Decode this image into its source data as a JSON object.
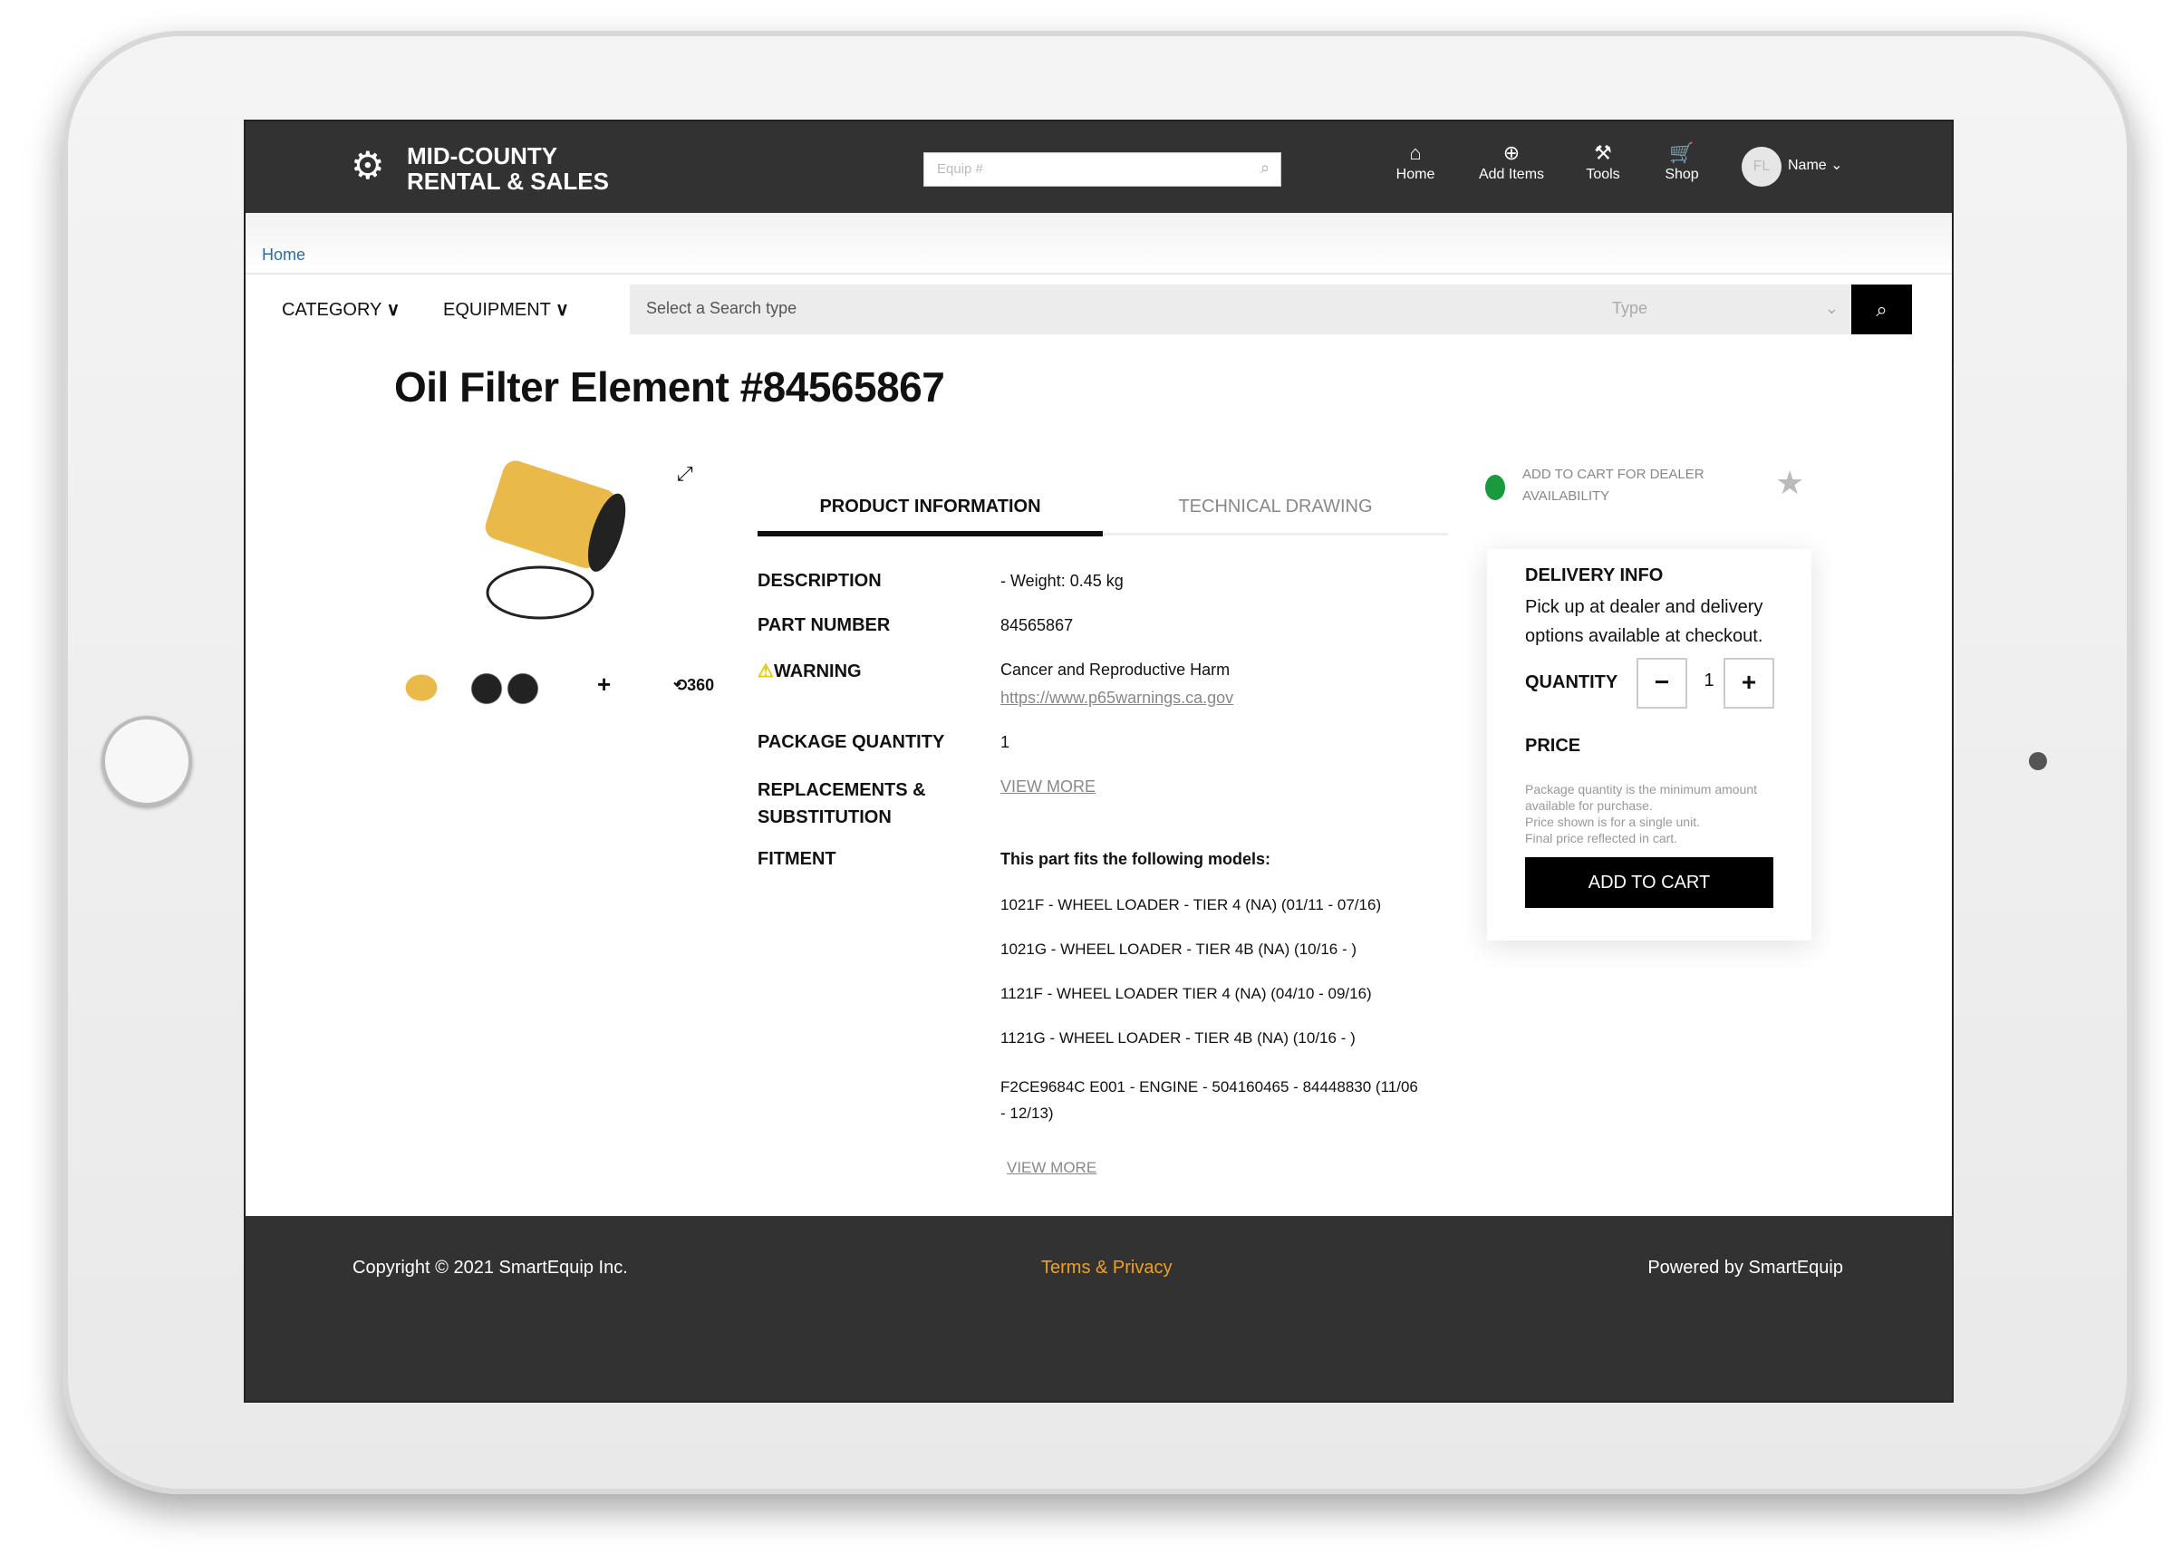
{
  "brand": {
    "line1": "MID-COUNTY",
    "line2": "RENTAL & SALES"
  },
  "header": {
    "search_placeholder": "Equip #",
    "nav": [
      {
        "label": "Home",
        "icon": "home-icon"
      },
      {
        "label": "Add Items",
        "icon": "plus-circle-icon"
      },
      {
        "label": "Tools",
        "icon": "tools-icon"
      },
      {
        "label": "Shop",
        "icon": "cart-icon"
      }
    ],
    "avatar_initials": "FL",
    "user_name": "Name"
  },
  "breadcrumb": {
    "home": "Home"
  },
  "filters": {
    "category": "CATEGORY",
    "equipment": "EQUIPMENT",
    "search_placeholder": "Select a Search type",
    "type_placeholder": "Type"
  },
  "product": {
    "title": "Oil Filter Element #84565867",
    "tabs": [
      {
        "label": "PRODUCT INFORMATION",
        "active": true
      },
      {
        "label": "TECHNICAL DRAWING",
        "active": false
      }
    ],
    "description_label": "DESCRIPTION",
    "description": "- Weight: 0.45 kg",
    "part_number_label": "PART NUMBER",
    "part_number": "84565867",
    "warning_label": "WARNING",
    "warning_text": "Cancer and Reproductive Harm",
    "warning_link": "https://www.p65warnings.ca.gov",
    "package_quantity_label": "PACKAGE QUANTITY",
    "package_quantity": "1",
    "replacements_label_1": "REPLACEMENTS &",
    "replacements_label_2": "SUBSTITUTION",
    "view_more": "VIEW MORE",
    "fitment_label": "FITMENT",
    "fitment_intro": "This part fits the following models:",
    "fitment_models": [
      "1021F - WHEEL LOADER - TIER 4 (NA) (01/11 - 07/16)",
      "1021G - WHEEL LOADER - TIER 4B (NA) (10/16 - )",
      "1121F - WHEEL LOADER TIER 4 (NA) (04/10 - 09/16)",
      "1121G - WHEEL LOADER - TIER 4B (NA) (10/16 - )",
      "F2CE9684C E001 - ENGINE - 504160465 - 84448830 (11/06 - 12/13)"
    ],
    "fitment_view_more": "VIEW MORE",
    "rotate_label": "360"
  },
  "availability": {
    "text": "ADD TO CART FOR DEALER AVAILABILITY",
    "status_color": "#1a9a3c"
  },
  "card": {
    "delivery_title": "DELIVERY INFO",
    "delivery_text": "Pick up at dealer and delivery options available at checkout.",
    "quantity_label": "QUANTITY",
    "quantity": "1",
    "minus": "−",
    "plus": "+",
    "price_label": "PRICE",
    "price_note": [
      "Package quantity is the minimum amount available for purchase.",
      "Price shown is for a single unit.",
      "Final price reflected in cart."
    ],
    "add_to_cart": "ADD TO CART"
  },
  "footer": {
    "copyright": "Copyright © 2021 SmartEquip Inc.",
    "terms": "Terms & Privacy",
    "powered": "Powered by SmartEquip",
    "terms_color": "#f0a020"
  }
}
